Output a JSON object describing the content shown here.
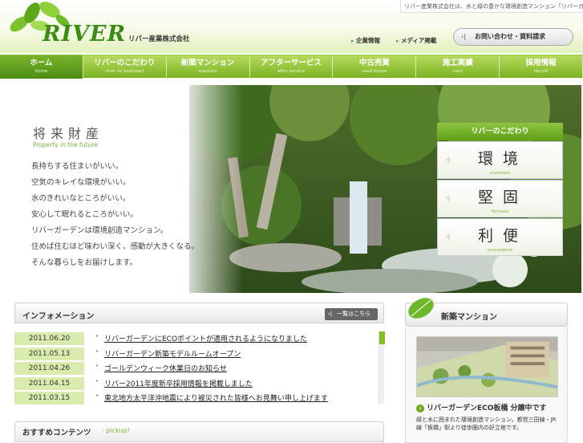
{
  "header": {
    "top_strip_text": "リバー産業株式会社は、水と緑の豊かな環境創造マンション「リバーガーデン」を提供しています",
    "logo_text": "RIVER",
    "company_name": "リバー産業株式会社",
    "links": [
      "企業情報",
      "メディア掲載"
    ],
    "contact_label": "お問い合わせ・資料請求"
  },
  "nav": {
    "items": [
      {
        "label": "ホーム",
        "sub": "home"
      },
      {
        "label": "リバーのこだわり",
        "sub": "river no kodawari"
      },
      {
        "label": "新築マンション",
        "sub": "mansion"
      },
      {
        "label": "アフターサービス",
        "sub": "after service"
      },
      {
        "label": "中古売買",
        "sub": "used house"
      },
      {
        "label": "施工実績",
        "sub": "care"
      },
      {
        "label": "採用情報",
        "sub": "recruit"
      }
    ]
  },
  "hero": {
    "title": "将来財産",
    "subtitle": "Property in the future",
    "lines": [
      "長持ちする住まいがいい。",
      "空気のキレイな環境がいい。",
      "水のきれいなところがいい。",
      "安心して眠れるところがいい。",
      "リバーガーデンは環境創造マンション。",
      "住めば住むほど味わい深く、感動が大きくなる。",
      "そんな暮らしをお届けします。"
    ],
    "panel": {
      "title": "リバーのこだわり",
      "cards": [
        {
          "kanji": "環境",
          "en": "envirment"
        },
        {
          "kanji": "堅固",
          "en": "firmness"
        },
        {
          "kanji": "利便",
          "en": "convenience"
        }
      ]
    }
  },
  "info": {
    "title": "インフォメーション",
    "more_label": "一覧はこちら",
    "items": [
      {
        "date": "2011.06.20",
        "text": "リバーガーデンにECOポイントが適用されるようになりました"
      },
      {
        "date": "2011.05.13",
        "text": "リバーガーデン新築モデルルームオープン"
      },
      {
        "date": "2011.04.26",
        "text": "ゴールデンウィーク休業日のお知らせ"
      },
      {
        "date": "2011.04.15",
        "text": "リバー2011年度新卒採用情報を掲載しました"
      },
      {
        "date": "2011.03.15",
        "text": "東北地方太平洋沖地震により被災された皆様へお見舞い申し上げます"
      }
    ]
  },
  "pickup": {
    "title": "おすすめコンテンツ",
    "subtitle": "- pickup!"
  },
  "mansion": {
    "title": "新築マンション",
    "caption": "リバーガーデンECO板橋 分譲中です",
    "description": "緑と水に囲まれた環境創造マンション。都営三田線・JR線「板橋」駅より徒歩圏内の好立地です。"
  }
}
